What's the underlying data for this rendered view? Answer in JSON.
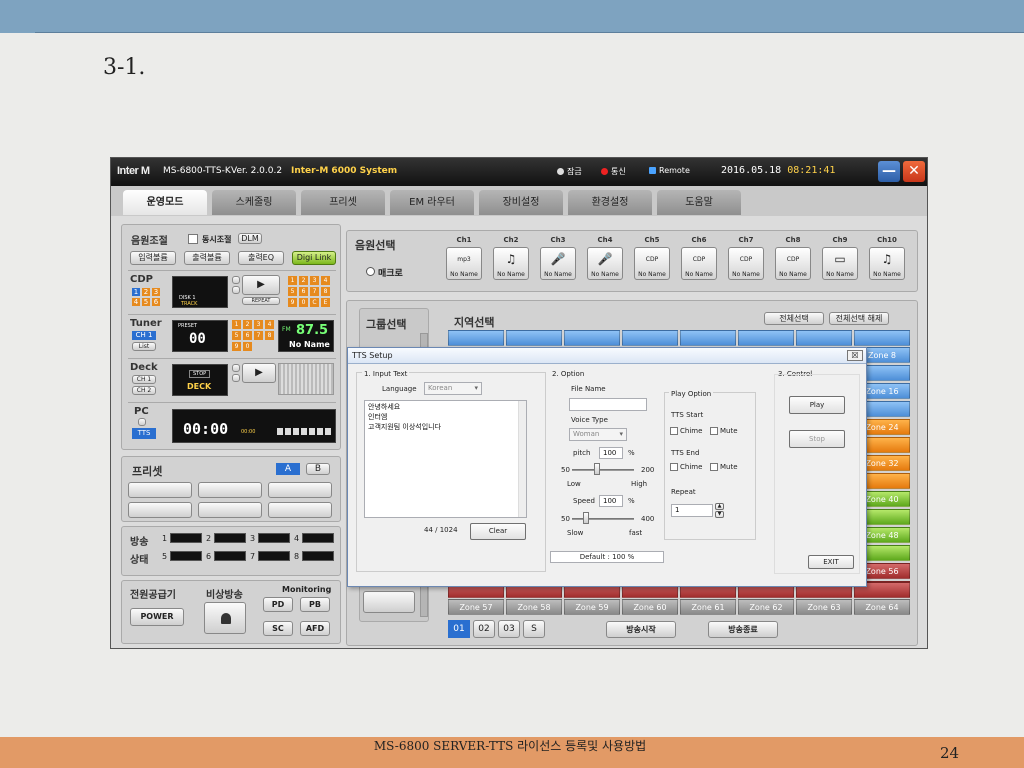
{
  "slide": {
    "heading": "3-1.",
    "footer": "MS-6800 SERVER-TTS 라이선스 등록및 사용방법",
    "page_number": "24"
  },
  "app": {
    "logo": "Inter M",
    "model": "MS-6800-TTS-K",
    "version": "Ver. 2.0.0.2",
    "system_name": "Inter-M 6000 System",
    "status_lock": "잠금",
    "status_comm": "통신",
    "status_remote": "Remote",
    "date": "2016.05.18",
    "time": "08:21:41",
    "minimize": "—",
    "close": "✕"
  },
  "tabs": [
    "운영모드",
    "스케줄링",
    "프리셋",
    "EM 라우터",
    "장비설정",
    "환경설정",
    "도움말"
  ],
  "source_control": {
    "title": "음원조절",
    "simul_label": "동시조절",
    "dlm": "DLM",
    "input_vol": "입력볼륨",
    "output_vol": "출력볼륨",
    "output_eq": "출력EQ",
    "digi_link": "Digi Link"
  },
  "cdp": {
    "label": "CDP",
    "disp_line1": "DISK 1",
    "disp_line2": "TRACK",
    "keys": [
      "1",
      "2",
      "3",
      "4",
      "5",
      "6"
    ],
    "numpad": [
      "1",
      "2",
      "3",
      "4",
      "5",
      "6",
      "7",
      "8",
      "9",
      "0",
      "C",
      "E"
    ],
    "repeat": "REPEAT",
    "play": "▶"
  },
  "tuner": {
    "label": "Tuner",
    "ch1": "CH 1",
    "list": "List",
    "preset": "PRESET",
    "preset_num": "00",
    "band": "FM",
    "freq": "87.5",
    "station": "No Name",
    "numpad": [
      "1",
      "2",
      "3",
      "4",
      "5",
      "6",
      "7",
      "8",
      "9",
      "0"
    ]
  },
  "deck": {
    "label": "Deck",
    "ch1": "CH 1",
    "ch2": "CH 2",
    "stop": "STOP",
    "name": "DECK",
    "play": "▶"
  },
  "pc": {
    "label": "PC",
    "tts": "TTS",
    "time": "00:00",
    "small_time": "00:00"
  },
  "preset_panel": {
    "title": "프리셋",
    "a": "A",
    "b": "B"
  },
  "broadcast_status": {
    "label1": "방송",
    "label2": "상태",
    "slots": [
      "1",
      "2",
      "3",
      "4",
      "5",
      "6",
      "7",
      "8"
    ]
  },
  "power": {
    "title": "전원공급기",
    "power_btn": "POWER",
    "emergency": "비상방송",
    "monitoring": "Monitoring",
    "pd": "PD",
    "pb": "PB",
    "sc": "SC",
    "afd": "AFD"
  },
  "source_select": {
    "title": "음원선택",
    "macro": "매크로",
    "channels": [
      {
        "label": "Ch1",
        "icon": "mp3",
        "name": "No Name"
      },
      {
        "label": "Ch2",
        "icon": "♫",
        "name": "No Name"
      },
      {
        "label": "Ch3",
        "icon": "🎤",
        "name": "No Name"
      },
      {
        "label": "Ch4",
        "icon": "🎤",
        "name": "No Name"
      },
      {
        "label": "Ch5",
        "icon": "CDP",
        "name": "No Name"
      },
      {
        "label": "Ch6",
        "icon": "CDP",
        "name": "No Name"
      },
      {
        "label": "Ch7",
        "icon": "CDP",
        "name": "No Name"
      },
      {
        "label": "Ch8",
        "icon": "CDP",
        "name": "No Name"
      },
      {
        "label": "Ch9",
        "icon": "▭",
        "name": "No Name"
      },
      {
        "label": "Ch10",
        "icon": "♫",
        "name": "No Name"
      }
    ]
  },
  "group_select": {
    "title": "그룹선택"
  },
  "zone_select": {
    "title": "지역선택",
    "select_all": "전체선택",
    "deselect_all": "전체선택 해제",
    "right_zones": [
      "Zone 8",
      "Zone 16",
      "Zone 24",
      "Zone 32",
      "Zone 40",
      "Zone 48",
      "Zone 56"
    ],
    "bottom_zones": [
      "Zone 57",
      "Zone 58",
      "Zone 59",
      "Zone 60",
      "Zone 61",
      "Zone 62",
      "Zone 63",
      "Zone 64"
    ],
    "pages": [
      "01",
      "02",
      "03",
      "S"
    ],
    "start": "방송시작",
    "stop": "방송종료"
  },
  "tts_dialog": {
    "title": "TTS Setup",
    "close": "☒",
    "input_section": "1. Input Text",
    "language_label": "Language",
    "language_value": "Korean",
    "text_lines": [
      "안녕하세요",
      "인터엠",
      "고객지원팀 이상석입니다"
    ],
    "char_count": "44 / 1024",
    "clear": "Clear",
    "option_section": "2. Option",
    "file_name": "File Name",
    "voice_type": "Voice Type",
    "voice_value": "Woman",
    "pitch_label": "pitch",
    "pitch_value": "100",
    "pitch_unit": "%",
    "pitch_min": "50",
    "pitch_max": "200",
    "low": "Low",
    "high": "High",
    "speed_label": "Speed",
    "speed_value": "100",
    "speed_unit": "%",
    "speed_min": "50",
    "speed_max": "400",
    "slow": "Slow",
    "fast": "fast",
    "play_option": "Play Option",
    "tts_start": "TTS Start",
    "tts_end": "TTS End",
    "chime": "Chime",
    "mute": "Mute",
    "repeat": "Repeat",
    "repeat_value": "1",
    "status": "Default : 100 %",
    "control_section": "3. Control",
    "play": "Play",
    "stop": "Stop",
    "exit": "EXIT"
  },
  "colors": {
    "header_bar": "#7ea3c0",
    "footer_bar": "#e29a66",
    "accent_yellow": "#ffd24a",
    "zone_blue": "#4e8fd8"
  }
}
